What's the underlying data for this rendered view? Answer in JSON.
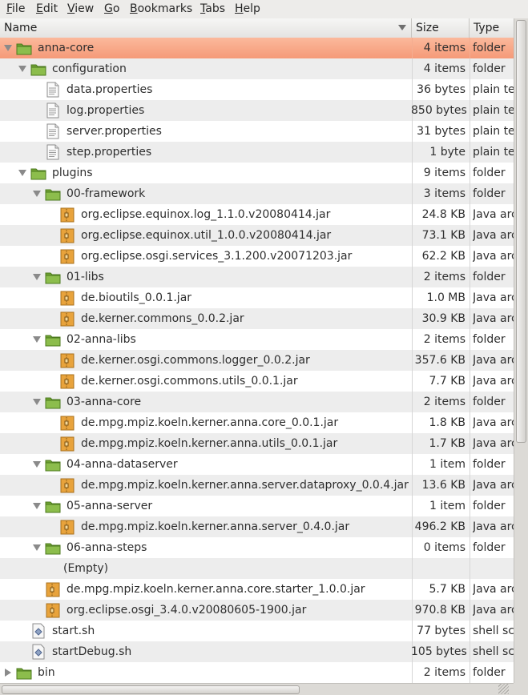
{
  "menu": [
    "File",
    "Edit",
    "View",
    "Go",
    "Bookmarks",
    "Tabs",
    "Help"
  ],
  "columns": {
    "name": "Name",
    "size": "Size",
    "type": "Type"
  },
  "rows": [
    {
      "level": 0,
      "expander": "open",
      "icon": "folder",
      "name": "anna-core",
      "size": "4 items",
      "type": "folder",
      "selected": true
    },
    {
      "level": 1,
      "expander": "open",
      "icon": "folder",
      "name": "configuration",
      "size": "4 items",
      "type": "folder"
    },
    {
      "level": 2,
      "expander": "none",
      "icon": "text-file",
      "name": "data.properties",
      "size": "36 bytes",
      "type": "plain text document"
    },
    {
      "level": 2,
      "expander": "none",
      "icon": "text-file",
      "name": "log.properties",
      "size": "850 bytes",
      "type": "plain text document"
    },
    {
      "level": 2,
      "expander": "none",
      "icon": "text-file",
      "name": "server.properties",
      "size": "31 bytes",
      "type": "plain text document"
    },
    {
      "level": 2,
      "expander": "none",
      "icon": "text-file",
      "name": "step.properties",
      "size": "1 byte",
      "type": "plain text document"
    },
    {
      "level": 1,
      "expander": "open",
      "icon": "folder",
      "name": "plugins",
      "size": "9 items",
      "type": "folder"
    },
    {
      "level": 2,
      "expander": "open",
      "icon": "folder",
      "name": "00-framework",
      "size": "3 items",
      "type": "folder"
    },
    {
      "level": 3,
      "expander": "none",
      "icon": "jar",
      "name": "org.eclipse.equinox.log_1.1.0.v20080414.jar",
      "size": "24.8 KB",
      "type": "Java archive"
    },
    {
      "level": 3,
      "expander": "none",
      "icon": "jar",
      "name": "org.eclipse.equinox.util_1.0.0.v20080414.jar",
      "size": "73.1 KB",
      "type": "Java archive"
    },
    {
      "level": 3,
      "expander": "none",
      "icon": "jar",
      "name": "org.eclipse.osgi.services_3.1.200.v20071203.jar",
      "size": "62.2 KB",
      "type": "Java archive"
    },
    {
      "level": 2,
      "expander": "open",
      "icon": "folder",
      "name": "01-libs",
      "size": "2 items",
      "type": "folder"
    },
    {
      "level": 3,
      "expander": "none",
      "icon": "jar",
      "name": "de.bioutils_0.0.1.jar",
      "size": "1.0 MB",
      "type": "Java archive"
    },
    {
      "level": 3,
      "expander": "none",
      "icon": "jar",
      "name": "de.kerner.commons_0.0.2.jar",
      "size": "30.9 KB",
      "type": "Java archive"
    },
    {
      "level": 2,
      "expander": "open",
      "icon": "folder",
      "name": "02-anna-libs",
      "size": "2 items",
      "type": "folder"
    },
    {
      "level": 3,
      "expander": "none",
      "icon": "jar",
      "name": "de.kerner.osgi.commons.logger_0.0.2.jar",
      "size": "357.6 KB",
      "type": "Java archive"
    },
    {
      "level": 3,
      "expander": "none",
      "icon": "jar",
      "name": "de.kerner.osgi.commons.utils_0.0.1.jar",
      "size": "7.7 KB",
      "type": "Java archive"
    },
    {
      "level": 2,
      "expander": "open",
      "icon": "folder",
      "name": "03-anna-core",
      "size": "2 items",
      "type": "folder"
    },
    {
      "level": 3,
      "expander": "none",
      "icon": "jar",
      "name": "de.mpg.mpiz.koeln.kerner.anna.core_0.0.1.jar",
      "size": "1.8 KB",
      "type": "Java archive"
    },
    {
      "level": 3,
      "expander": "none",
      "icon": "jar",
      "name": "de.mpg.mpiz.koeln.kerner.anna.utils_0.0.1.jar",
      "size": "1.7 KB",
      "type": "Java archive"
    },
    {
      "level": 2,
      "expander": "open",
      "icon": "folder",
      "name": "04-anna-dataserver",
      "size": "1 item",
      "type": "folder"
    },
    {
      "level": 3,
      "expander": "none",
      "icon": "jar",
      "name": "de.mpg.mpiz.koeln.kerner.anna.server.dataproxy_0.0.4.jar",
      "size": "13.6 KB",
      "type": "Java archive"
    },
    {
      "level": 2,
      "expander": "open",
      "icon": "folder",
      "name": "05-anna-server",
      "size": "1 item",
      "type": "folder"
    },
    {
      "level": 3,
      "expander": "none",
      "icon": "jar",
      "name": "de.mpg.mpiz.koeln.kerner.anna.server_0.4.0.jar",
      "size": "496.2 KB",
      "type": "Java archive"
    },
    {
      "level": 2,
      "expander": "open",
      "icon": "folder",
      "name": "06-anna-steps",
      "size": "0 items",
      "type": "folder"
    },
    {
      "level": 3,
      "expander": "none",
      "icon": "none",
      "name": "(Empty)",
      "size": "",
      "type": ""
    },
    {
      "level": 2,
      "expander": "none",
      "icon": "jar",
      "name": "de.mpg.mpiz.koeln.kerner.anna.core.starter_1.0.0.jar",
      "size": "5.7 KB",
      "type": "Java archive"
    },
    {
      "level": 2,
      "expander": "none",
      "icon": "jar",
      "name": "org.eclipse.osgi_3.4.0.v20080605-1900.jar",
      "size": "970.8 KB",
      "type": "Java archive"
    },
    {
      "level": 1,
      "expander": "none",
      "icon": "script",
      "name": "start.sh",
      "size": "77 bytes",
      "type": "shell script"
    },
    {
      "level": 1,
      "expander": "none",
      "icon": "script",
      "name": "startDebug.sh",
      "size": "105 bytes",
      "type": "shell script"
    },
    {
      "level": 0,
      "expander": "closed",
      "icon": "folder",
      "name": "bin",
      "size": "2 items",
      "type": "folder"
    }
  ],
  "colors": {
    "selected": "#f59a78",
    "folder": "#8cbd4c",
    "jar": "#e8a33c",
    "stripe": "#ededed"
  }
}
